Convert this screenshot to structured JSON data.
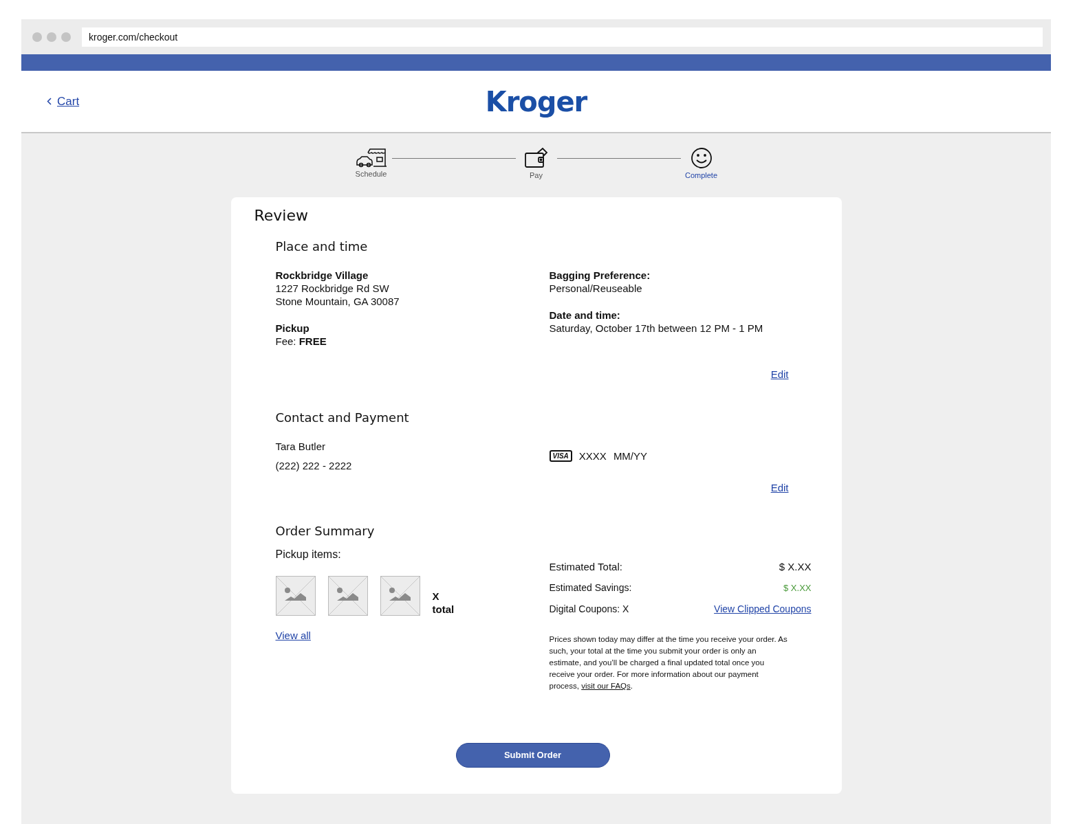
{
  "browser": {
    "url": "kroger.com/checkout"
  },
  "header": {
    "back_link": "Cart",
    "logo": "Kroger"
  },
  "steps": [
    {
      "kind": "schedule",
      "label": "Schedule",
      "selected": false
    },
    {
      "kind": "pay",
      "label": "Pay",
      "selected": false
    },
    {
      "kind": "complete",
      "label": "Complete",
      "selected": true
    }
  ],
  "review": {
    "title": "Review",
    "place_and_time": {
      "heading": "Place and time",
      "store_name": "Rockbridge Village",
      "address_lines": [
        "1227 Rockbridge Rd SW",
        "Stone Mountain, GA 30087"
      ],
      "method": "Pickup",
      "fee": "Fee: **FREE**",
      "bagging_label": "Bagging Preference:",
      "bagging_value": "Personal/Reuseable",
      "date_label": "Date and time:",
      "date_value": "Saturday, October 17th between 12 PM - 1 PM",
      "edit": "Edit"
    },
    "contact_and_payment": {
      "heading": "Contact and Payment",
      "name": "Tara Butler",
      "phone": "(222) 222 - 2222",
      "card_brand": "VISA",
      "card_number": "XXXX",
      "card_expiry": "MM/YY",
      "edit": "Edit"
    },
    "order_summary": {
      "heading": "Order Summary",
      "items_label": "Pickup items:",
      "item_images": [
        {
          "kind": "placeholder"
        },
        {
          "kind": "placeholder"
        },
        {
          "kind": "placeholder"
        }
      ],
      "count_value": "X",
      "count_label": "total",
      "view_all": "View all",
      "estimated_total_label": "Estimated Total:",
      "estimated_total": "$ X.XX",
      "savings_label": "Estimated Savings:",
      "savings": "$ X.XX",
      "coupons_label": "Digital Coupons: X",
      "coupons_link": "View Clipped Coupons",
      "note": "Prices shown today may differ at the time you receive your order. As such, your total at the time you submit your order is only an estimate, and you’ll be charged a final updated total once you receive your order. For more information about our payment process, ",
      "note_link": "visit our FAQs",
      "note_end": "."
    },
    "submit": "Submit Order"
  }
}
